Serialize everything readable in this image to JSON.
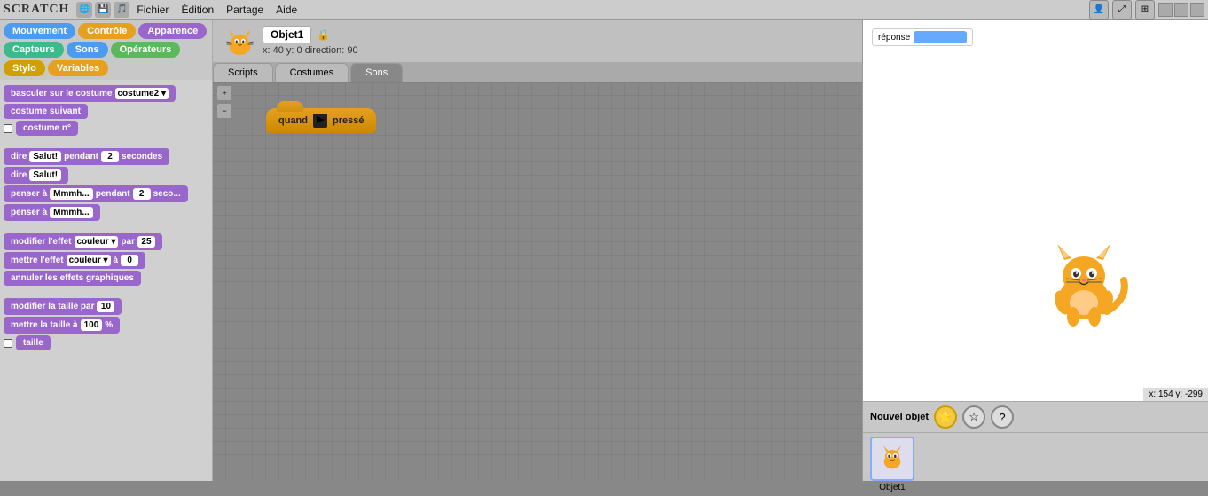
{
  "topbar": {
    "logo": "SCRATCH",
    "menu": [
      "Fichier",
      "Édition",
      "Partage",
      "Aide"
    ],
    "icons": [
      "🌐",
      "💾",
      "🎵"
    ]
  },
  "sidebar": {
    "tabs": [
      {
        "label": "Mouvement",
        "color": "tab-blue"
      },
      {
        "label": "Contrôle",
        "color": "tab-orange"
      },
      {
        "label": "Apparence",
        "color": "tab-purple"
      },
      {
        "label": "Capteurs",
        "color": "tab-teal"
      },
      {
        "label": "Sons",
        "color": "tab-blue"
      },
      {
        "label": "Opérateurs",
        "color": "tab-green"
      },
      {
        "label": "Stylo",
        "color": "tab-yellow"
      },
      {
        "label": "Variables",
        "color": "tab-orange"
      }
    ],
    "blocks": [
      {
        "text": "basculer sur le costume",
        "type": "purple",
        "input": "costume2"
      },
      {
        "text": "costume suivant",
        "type": "purple"
      },
      {
        "text": "costume n°",
        "type": "checkbox-purple"
      },
      {
        "text": "dire",
        "type": "say",
        "input1": "Salut!",
        "mid": "pendant",
        "input2": "2",
        "end": "secondes"
      },
      {
        "text": "dire",
        "type": "say2",
        "input1": "Salut!"
      },
      {
        "text": "penser à",
        "type": "think",
        "input1": "Mmmh...",
        "mid": "pendant",
        "input2": "2",
        "end": "seco..."
      },
      {
        "text": "penser à",
        "type": "think2",
        "input1": "Mmmh..."
      },
      {
        "text": "modifier l'effet",
        "type": "effect",
        "input1": "couleur",
        "mid": "par",
        "input2": "25"
      },
      {
        "text": "mettre l'effet",
        "type": "effect2",
        "input1": "couleur",
        "mid": "à",
        "input2": "0"
      },
      {
        "text": "annuler les effets graphiques",
        "type": "purple"
      },
      {
        "text": "modifier la taille par",
        "type": "purple",
        "input": "10"
      },
      {
        "text": "mettre la taille à",
        "type": "purple",
        "input1": "100",
        "end": "%"
      },
      {
        "text": "taille",
        "type": "checkbox-purple"
      }
    ]
  },
  "script_area": {
    "header": {
      "object_name": "Objet1",
      "coords": "x: 40  y: 0  direction: 90"
    },
    "tabs": [
      "Scripts",
      "Costumes",
      "Sons"
    ],
    "active_tab": "Scripts",
    "when_flag_label": "quand",
    "when_flag_pressed": "pressé"
  },
  "stage": {
    "response_label": "réponse",
    "coords": "x: 154  y: -299"
  },
  "bottom": {
    "new_object_label": "Nouvel objet",
    "sprites": [
      {
        "name": "Objet1"
      }
    ]
  }
}
